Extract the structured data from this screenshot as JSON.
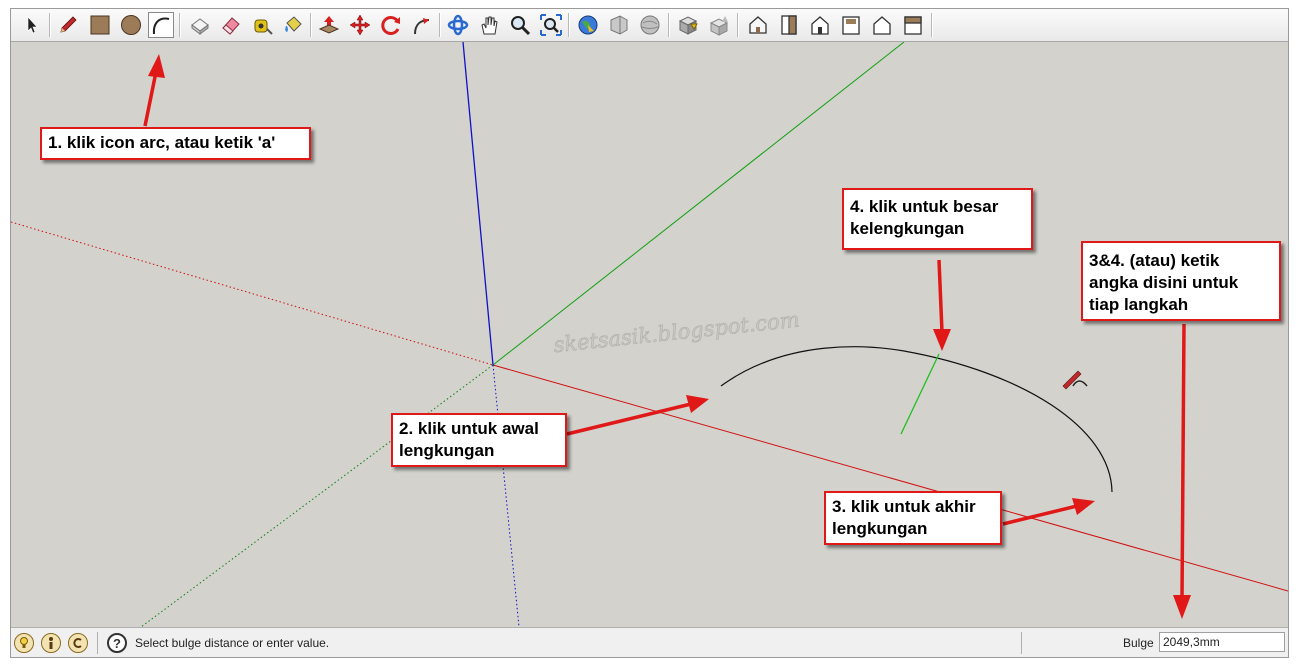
{
  "toolbar": {
    "tools": [
      {
        "name": "select-tool",
        "icon": "arrow-cursor-icon"
      },
      {
        "name": "pencil-tool",
        "icon": "pencil-icon"
      },
      {
        "name": "rectangle-tool",
        "icon": "rectangle-icon"
      },
      {
        "name": "circle-tool",
        "icon": "circle-icon"
      },
      {
        "name": "arc-tool",
        "icon": "arc-icon",
        "active": true
      },
      {
        "name": "make-component-tool",
        "icon": "component-icon"
      },
      {
        "name": "eraser-tool",
        "icon": "eraser-icon"
      },
      {
        "name": "tape-measure-tool",
        "icon": "tape-measure-icon"
      },
      {
        "name": "paint-bucket-tool",
        "icon": "paint-bucket-icon"
      },
      {
        "name": "push-pull-tool",
        "icon": "push-pull-icon"
      },
      {
        "name": "move-tool",
        "icon": "move-icon"
      },
      {
        "name": "rotate-tool",
        "icon": "rotate-icon"
      },
      {
        "name": "follow-me-tool",
        "icon": "follow-me-icon"
      },
      {
        "name": "orbit-tool",
        "icon": "orbit-icon"
      },
      {
        "name": "pan-tool",
        "icon": "hand-icon"
      },
      {
        "name": "zoom-tool",
        "icon": "zoom-icon"
      },
      {
        "name": "zoom-extents-tool",
        "icon": "zoom-extents-icon"
      },
      {
        "name": "get-models-tool",
        "icon": "globe-icon"
      },
      {
        "name": "share-model-tool",
        "icon": "share-model-icon"
      },
      {
        "name": "google-earth-tool",
        "icon": "earth-icon"
      },
      {
        "name": "get-component-tool",
        "icon": "warehouse-box-icon"
      },
      {
        "name": "share-component-tool",
        "icon": "share-component-icon"
      },
      {
        "name": "iso-view",
        "icon": "iso-house-icon"
      },
      {
        "name": "top-view",
        "icon": "top-view-icon"
      },
      {
        "name": "front-view",
        "icon": "front-house-icon"
      },
      {
        "name": "right-view",
        "icon": "right-view-icon"
      },
      {
        "name": "back-view",
        "icon": "back-house-icon"
      },
      {
        "name": "left-view",
        "icon": "left-view-icon"
      }
    ]
  },
  "canvas": {
    "watermark": "sketsasik.blogspot.com",
    "colors": {
      "background": "#d3d2cd",
      "x_axis": "#d01010",
      "y_axis": "#10a010",
      "z_axis": "#1010c8",
      "arc": "#111111",
      "callout_border": "#e01818"
    }
  },
  "callouts": {
    "c1": "1. klik icon arc, atau ketik 'a'",
    "c2_line1": "2. klik untuk awal",
    "c2_line2": "lengkungan",
    "c3_line1": "3. klik untuk akhir",
    "c3_line2": "lengkungan",
    "c4_line1": "4. klik untuk besar",
    "c4_line2": "kelengkungan",
    "c5_line1": "3&4. (atau) ketik",
    "c5_line2": "angka disini untuk",
    "c5_line3": "tiap langkah"
  },
  "statusbar": {
    "icons": [
      "geo-location-icon",
      "credits-icon",
      "copyright-icon",
      "help-icon"
    ],
    "message": "Select bulge distance or enter value.",
    "vcb_label": "Bulge",
    "vcb_value": "2049,3mm"
  }
}
